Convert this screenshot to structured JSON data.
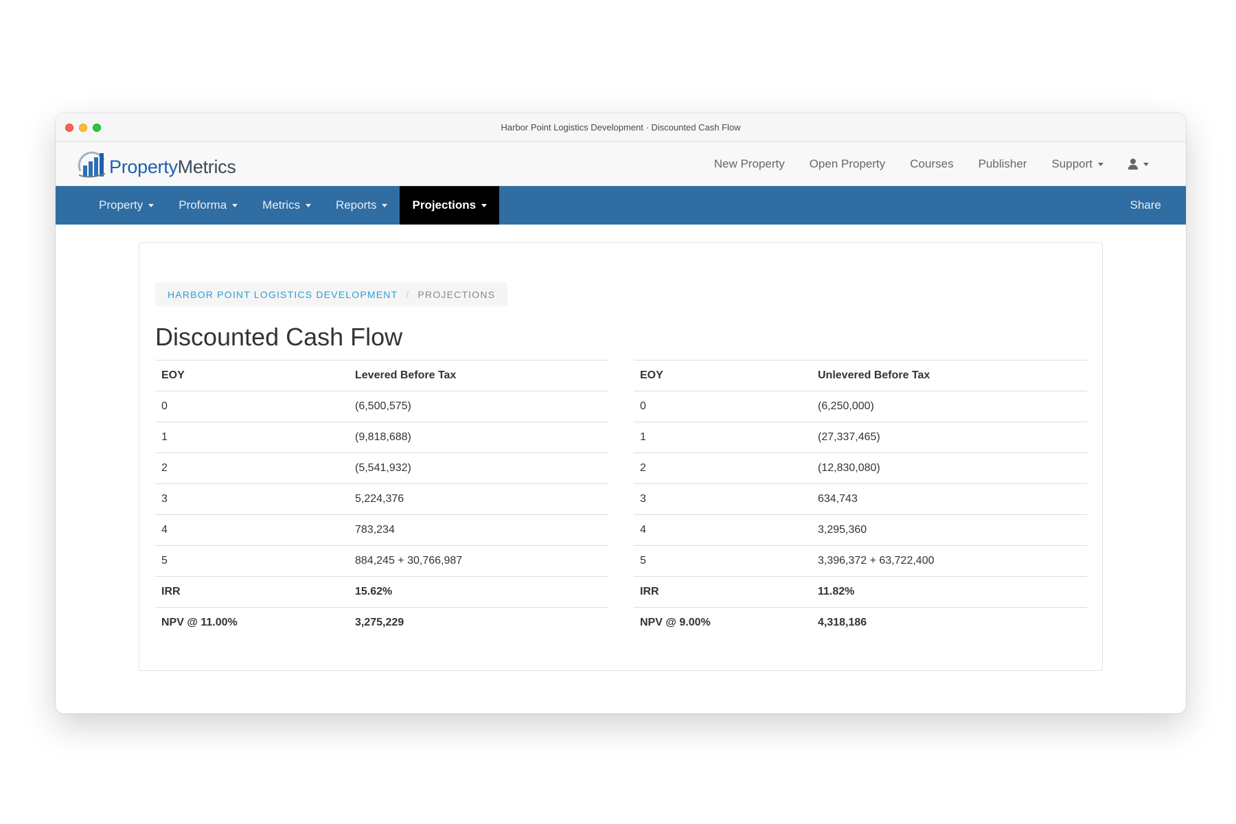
{
  "window": {
    "title": "Harbor Point Logistics Development · Discounted Cash Flow"
  },
  "logo": {
    "part1": "Property",
    "part2": "Metrics"
  },
  "topnav": {
    "links": [
      "New Property",
      "Open Property",
      "Courses",
      "Publisher",
      "Support"
    ],
    "user_icon": "user-icon"
  },
  "mainnav": {
    "items": [
      "Property",
      "Proforma",
      "Metrics",
      "Reports",
      "Projections"
    ],
    "active": "Projections",
    "share": "Share"
  },
  "breadcrumb": {
    "link": "Harbor Point Logistics Development",
    "separator": "/",
    "current": "Projections"
  },
  "page": {
    "title": "Discounted Cash Flow"
  },
  "levered": {
    "headers": [
      "EOY",
      "Levered Before Tax"
    ],
    "rows": [
      [
        "0",
        "(6,500,575)"
      ],
      [
        "1",
        "(9,818,688)"
      ],
      [
        "2",
        "(5,541,932)"
      ],
      [
        "3",
        "5,224,376"
      ],
      [
        "4",
        "783,234"
      ],
      [
        "5",
        "884,245 + 30,766,987"
      ]
    ],
    "irr": [
      "IRR",
      "15.62%"
    ],
    "npv": [
      "NPV @ 11.00%",
      "3,275,229"
    ]
  },
  "unlevered": {
    "headers": [
      "EOY",
      "Unlevered Before Tax"
    ],
    "rows": [
      [
        "0",
        "(6,250,000)"
      ],
      [
        "1",
        "(27,337,465)"
      ],
      [
        "2",
        "(12,830,080)"
      ],
      [
        "3",
        "634,743"
      ],
      [
        "4",
        "3,295,360"
      ],
      [
        "5",
        "3,396,372 + 63,722,400"
      ]
    ],
    "irr": [
      "IRR",
      "11.82%"
    ],
    "npv": [
      "NPV @ 9.00%",
      "4,318,186"
    ]
  },
  "colors": {
    "nav_blue": "#2f6da3",
    "active_tab": "#000000",
    "link_blue": "#2a9fd6",
    "logo_blue": "#1f5fae"
  }
}
